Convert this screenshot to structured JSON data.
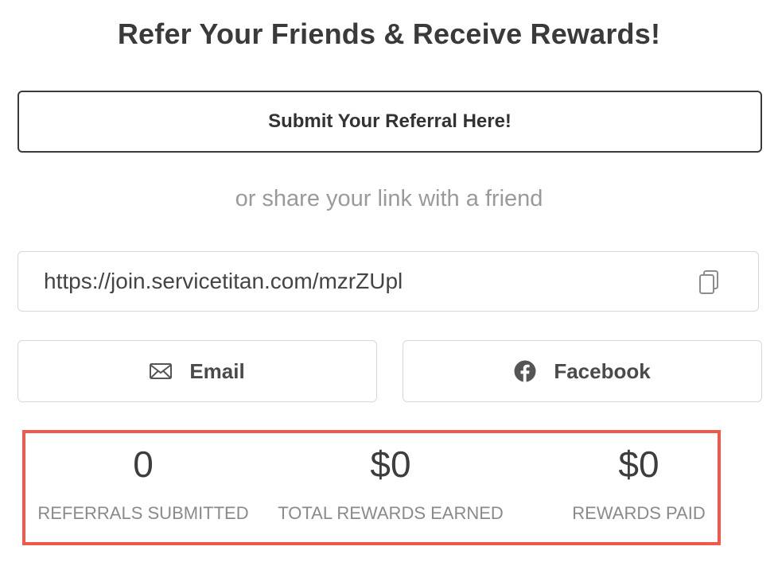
{
  "title": "Refer Your Friends & Receive Rewards!",
  "submit_button_label": "Submit Your Referral Here!",
  "share_prompt": "or share your link with a friend",
  "referral_link": {
    "value": "https://join.servicetitan.com/mzrZUpl"
  },
  "share_buttons": {
    "email_label": "Email",
    "facebook_label": "Facebook"
  },
  "stats": [
    {
      "value": "0",
      "label": "REFERRALS SUBMITTED"
    },
    {
      "value": "$0",
      "label": "TOTAL REWARDS EARNED"
    },
    {
      "value": "$0",
      "label": "REWARDS PAID"
    }
  ],
  "colors": {
    "highlight_border": "#f0584b",
    "button_border": "#3b3b3b",
    "muted_text": "#9a9a9a"
  },
  "icons": {
    "copy": "copy-icon",
    "email": "envelope-icon",
    "facebook": "facebook-icon"
  }
}
